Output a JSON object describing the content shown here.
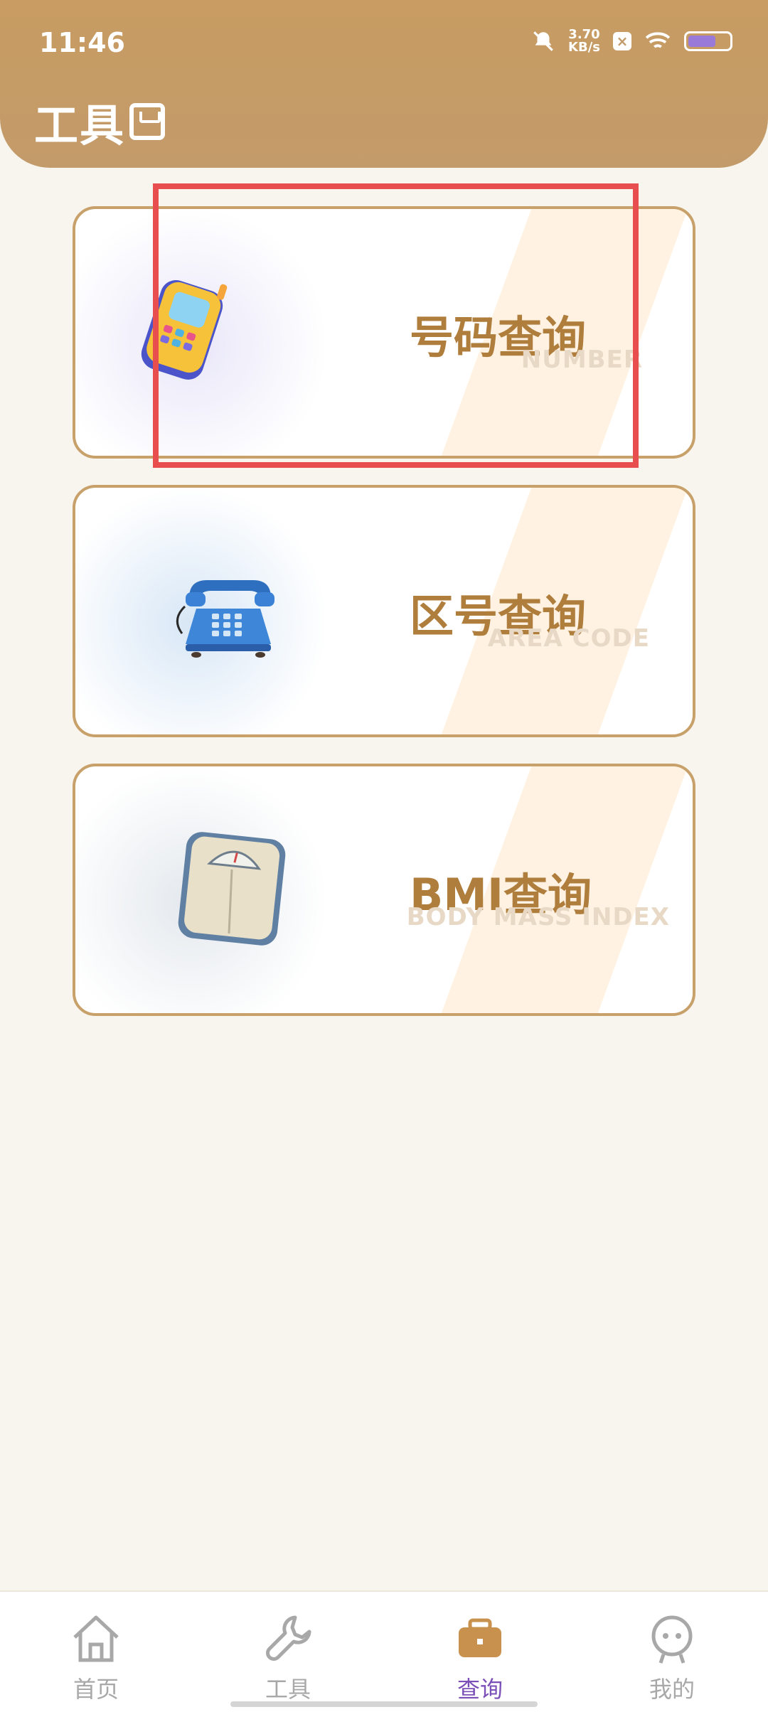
{
  "status": {
    "time": "11:46",
    "speed_value": "3.70",
    "speed_unit": "KB/s"
  },
  "header": {
    "title": "工具"
  },
  "cards": [
    {
      "title": "号码查询",
      "sub": "NUMBER",
      "icon": "mobile-phone-icon"
    },
    {
      "title": "区号查询",
      "sub": "AREA CODE",
      "icon": "telephone-icon"
    },
    {
      "title": "BMI查询",
      "sub": "BODY MASS INDEX",
      "icon": "scale-icon"
    }
  ],
  "nav": {
    "items": [
      {
        "label": "首页",
        "icon": "home-icon"
      },
      {
        "label": "工具",
        "icon": "wrench-icon"
      },
      {
        "label": "查询",
        "icon": "briefcase-icon",
        "active": true
      },
      {
        "label": "我的",
        "icon": "profile-icon"
      }
    ]
  },
  "colors": {
    "header": "#c39b6a",
    "accent": "#b07e3c",
    "active_nav": "#7b4fb8",
    "highlight": "#e84e4e"
  }
}
